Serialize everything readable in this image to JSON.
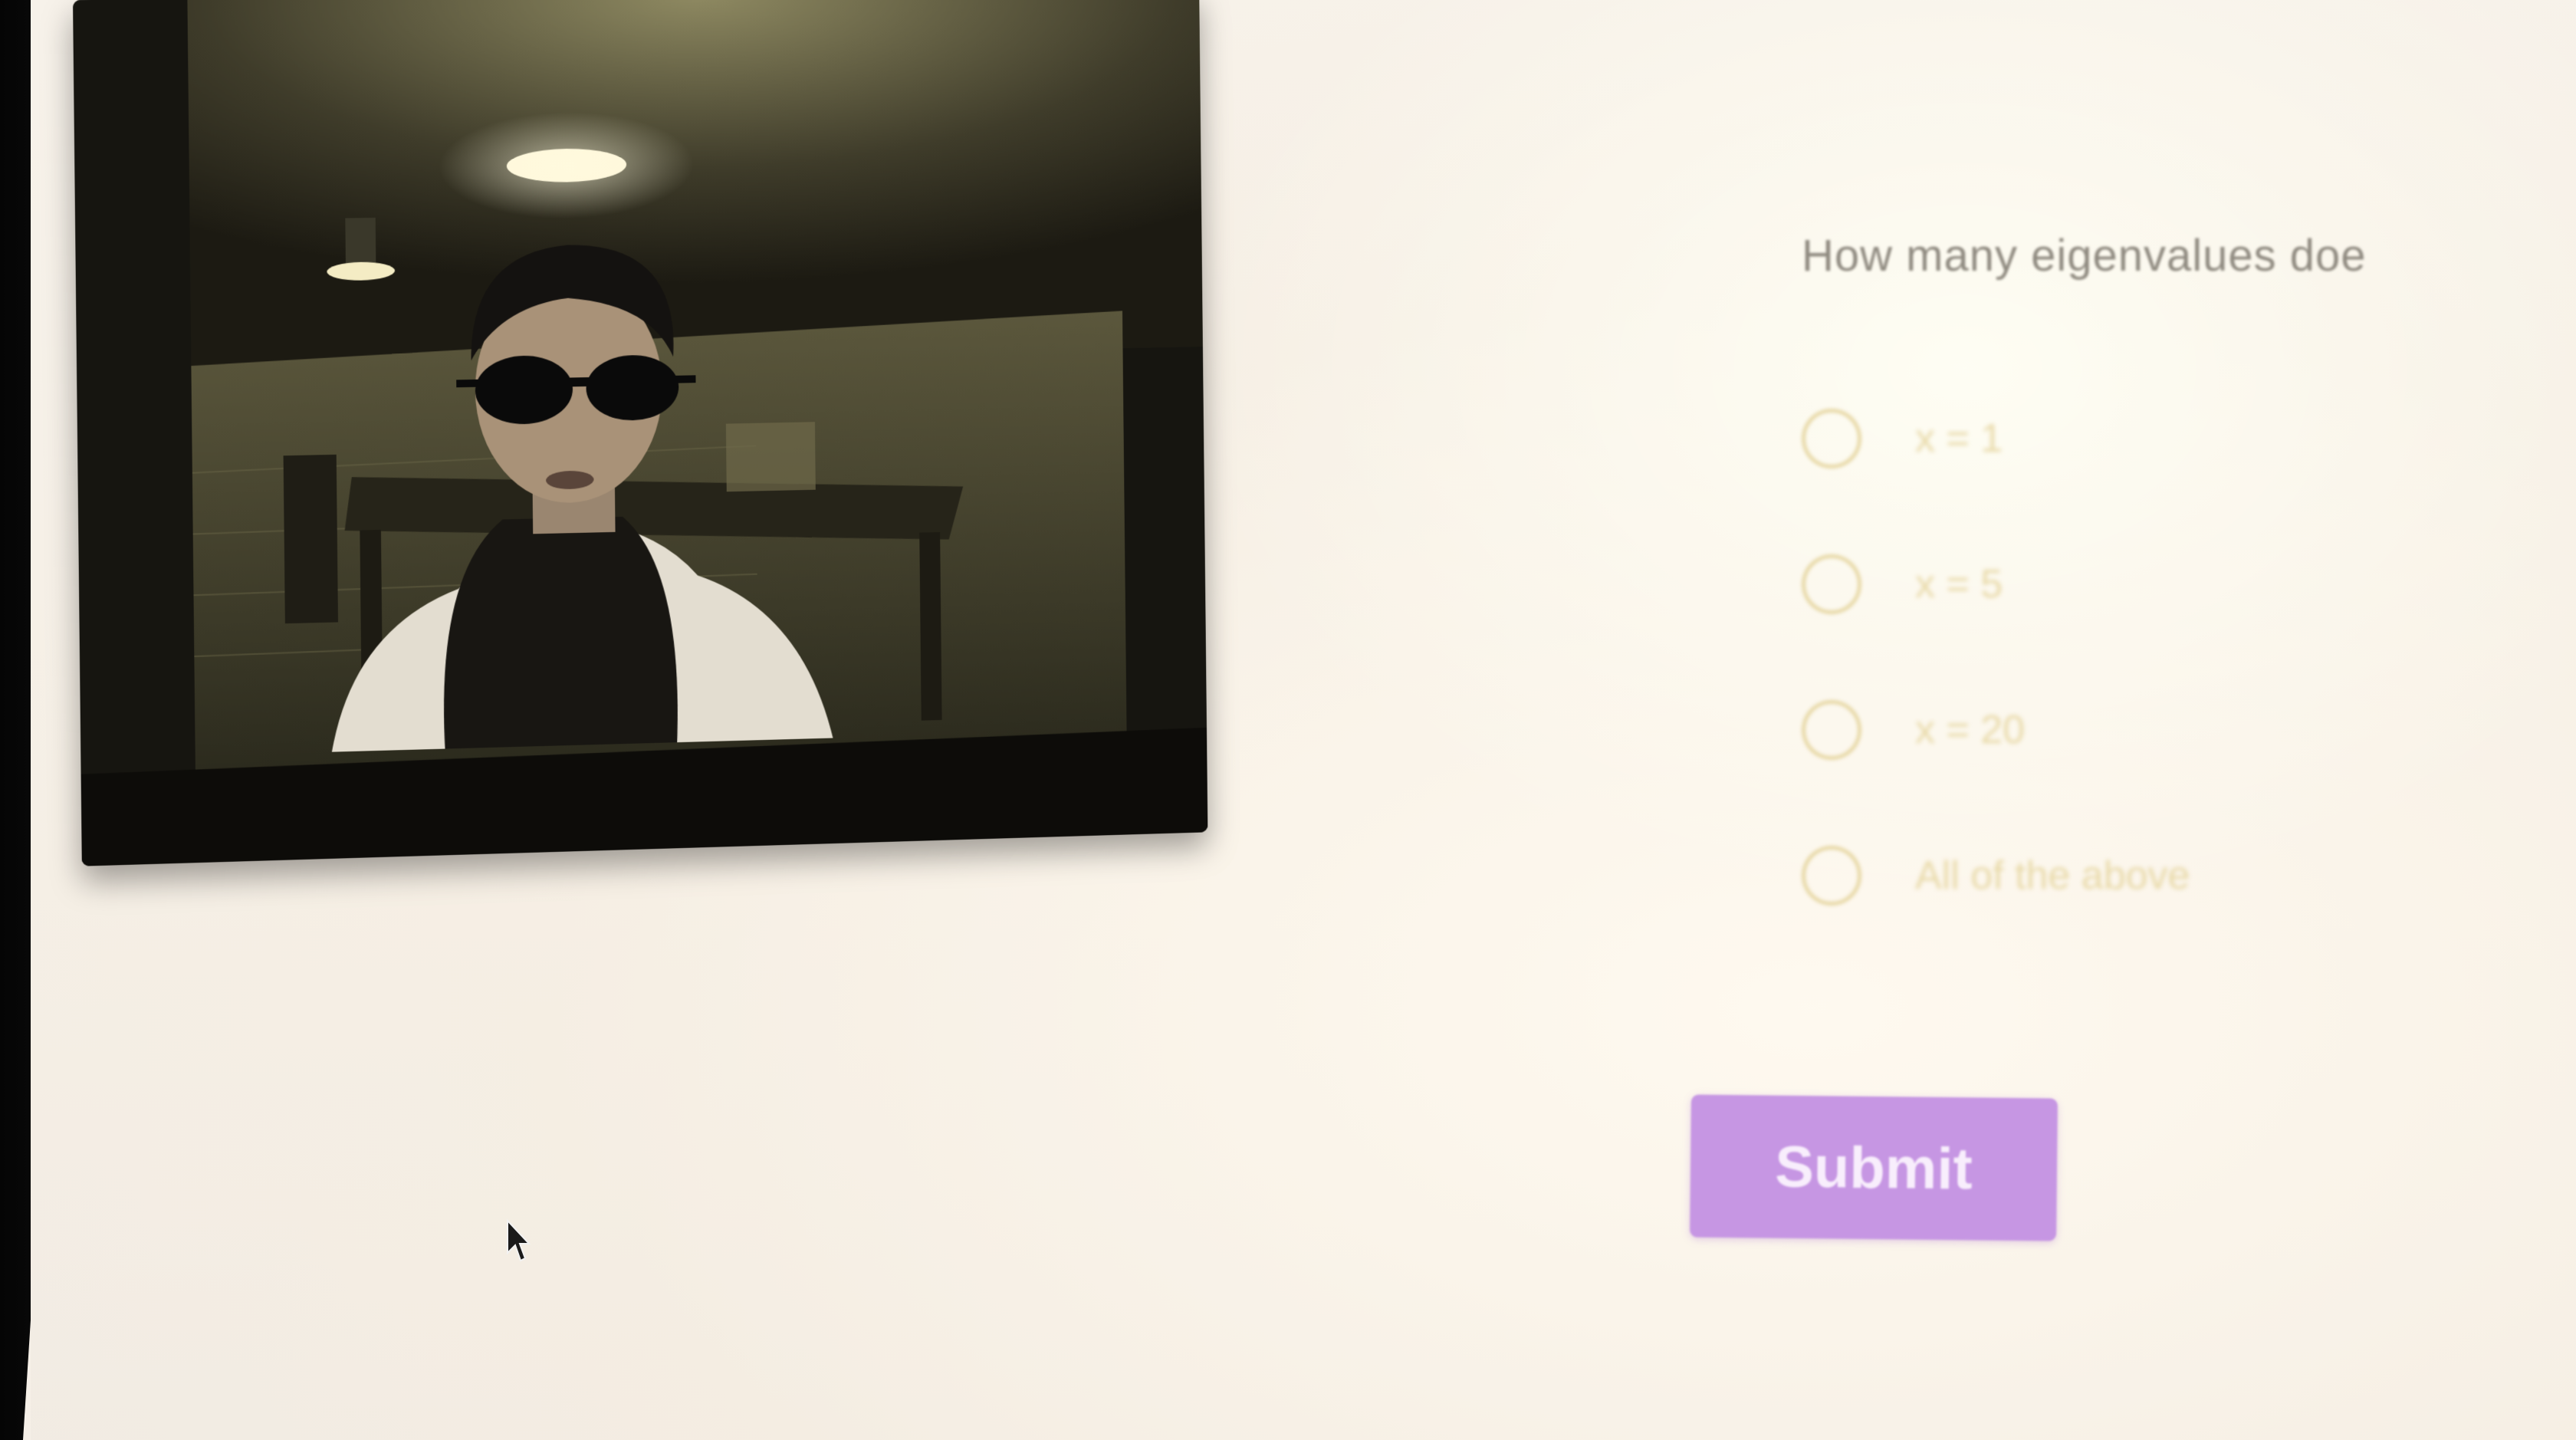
{
  "quiz": {
    "question": "How many eigenvalues doe",
    "options": [
      {
        "label": "x = 1"
      },
      {
        "label": "x = 5"
      },
      {
        "label": "x = 20"
      },
      {
        "label": "All of the above"
      }
    ],
    "submit_label": "Submit"
  },
  "colors": {
    "submit_bg": "#c696e3",
    "radio_border": "#e7d8a6",
    "question_text": "#8f8a80"
  }
}
